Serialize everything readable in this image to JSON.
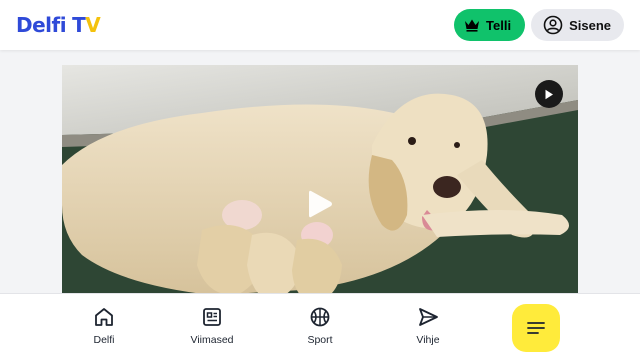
{
  "header": {
    "logo_part1": "Delfi",
    "logo_part2_t": "T",
    "logo_part2_v": "V",
    "subscribe_label": "Telli",
    "login_label": "Sisene"
  },
  "icons": {
    "subscribe": "crown-icon",
    "login": "user-circle-icon",
    "video_play_small": "play-icon",
    "video_play_big": "play-icon",
    "nav_home": "home-icon",
    "nav_latest": "news-icon",
    "nav_sport": "basketball-icon",
    "nav_tip": "send-icon",
    "menu": "menu-icon"
  },
  "colors": {
    "brand_blue": "#2f4ad8",
    "brand_yellow": "#f4c20d",
    "subscribe_green": "#10c26b",
    "menu_yellow": "#ffeb3b"
  },
  "bottom_nav": {
    "items": [
      {
        "label": "Delfi"
      },
      {
        "label": "Viimased"
      },
      {
        "label": "Sport"
      },
      {
        "label": "Vihje"
      }
    ]
  }
}
